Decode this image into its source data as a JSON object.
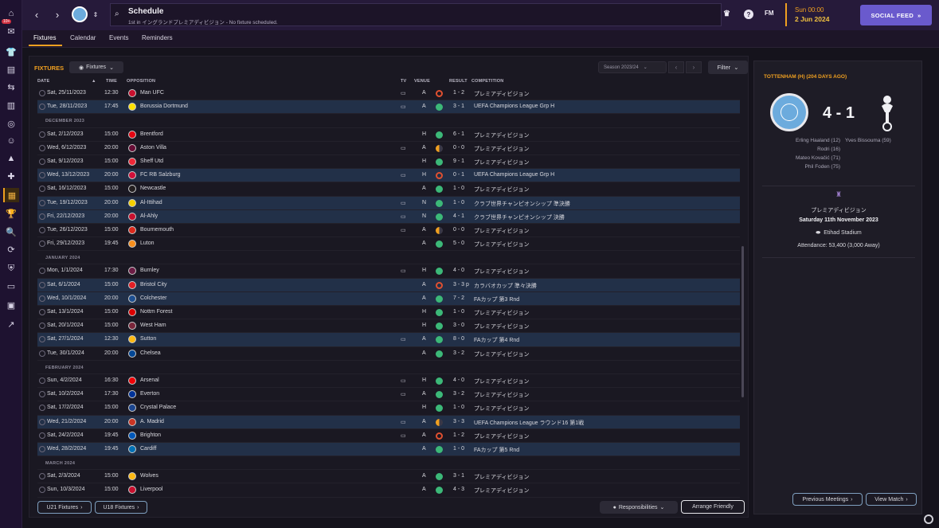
{
  "sidebar": {
    "badge": "10+",
    "items": [
      {
        "name": "home-icon",
        "glyph": "⌂"
      },
      {
        "name": "inbox-icon",
        "glyph": "✉"
      },
      {
        "name": "squad-icon",
        "glyph": "👕"
      },
      {
        "name": "reports-icon",
        "glyph": "▤"
      },
      {
        "name": "tactics-icon",
        "glyph": "⇆"
      },
      {
        "name": "data-hub-icon",
        "glyph": "▥"
      },
      {
        "name": "training-icon",
        "glyph": "◎"
      },
      {
        "name": "staff-icon",
        "glyph": "☺"
      },
      {
        "name": "dynamics-icon",
        "glyph": "▲"
      },
      {
        "name": "medical-icon",
        "glyph": "✚"
      },
      {
        "name": "schedule-icon",
        "glyph": "▦"
      },
      {
        "name": "competitions-icon",
        "glyph": "🏆"
      },
      {
        "name": "scouting-icon",
        "glyph": "🔍"
      },
      {
        "name": "transfers-icon",
        "glyph": "⟳"
      },
      {
        "name": "club-info-icon",
        "glyph": "⛨"
      },
      {
        "name": "club-vision-icon",
        "glyph": "▭"
      },
      {
        "name": "finances-icon",
        "glyph": "▣"
      },
      {
        "name": "dev-centre-icon",
        "glyph": "↗"
      }
    ]
  },
  "topbar": {
    "title": "Schedule",
    "subtitle": "1st in イングランドプレミアディビジョン - No fixture scheduled.",
    "fm": "FM",
    "time": "Sun 00:00",
    "date": "2 Jun 2024",
    "social": "SOCIAL FEED"
  },
  "tabs": [
    "Fixtures",
    "Calendar",
    "Events",
    "Reminders"
  ],
  "fixtures": {
    "title": "FIXTURES",
    "dropdown": "Fixtures",
    "season": "Season 2023/24",
    "filter": "Filter",
    "columns": {
      "date": "DATE",
      "time": "TIME",
      "opposition": "OPPOSITION",
      "tv": "TV",
      "venue": "VENUE",
      "result": "RESULT",
      "competition": "COMPETITION"
    },
    "rows": [
      {
        "date": "Sat, 25/11/2023",
        "time": "12:30",
        "opp": "Man UFC",
        "tv": true,
        "venue": "A",
        "res": "1 - 2",
        "comp": "プレミアディビジョン",
        "hl": false,
        "outcome": "L",
        "crest": "#c8102e"
      },
      {
        "date": "Tue, 28/11/2023",
        "time": "17:45",
        "opp": "Borussia Dortmund",
        "tv": true,
        "venue": "A",
        "res": "3 - 1",
        "comp": "UEFA Champions League Grp H",
        "hl": true,
        "outcome": "W",
        "crest": "#fde100"
      },
      {
        "month": "DECEMBER 2023"
      },
      {
        "date": "Sat, 2/12/2023",
        "time": "15:00",
        "opp": "Brentford",
        "tv": false,
        "venue": "H",
        "res": "6 - 1",
        "comp": "プレミアディビジョン",
        "hl": false,
        "outcome": "W",
        "crest": "#e30613"
      },
      {
        "date": "Wed, 6/12/2023",
        "time": "20:00",
        "opp": "Aston Villa",
        "tv": true,
        "venue": "A",
        "res": "0 - 0",
        "comp": "プレミアディビジョン",
        "hl": false,
        "outcome": "D",
        "crest": "#670e36"
      },
      {
        "date": "Sat, 9/12/2023",
        "time": "15:00",
        "opp": "Sheff Utd",
        "tv": false,
        "venue": "H",
        "res": "9 - 1",
        "comp": "プレミアディビジョン",
        "hl": false,
        "outcome": "W",
        "crest": "#ee2737"
      },
      {
        "date": "Wed, 13/12/2023",
        "time": "20:00",
        "opp": "FC RB Salzburg",
        "tv": true,
        "venue": "H",
        "res": "0 - 1",
        "comp": "UEFA Champions League Grp H",
        "hl": true,
        "outcome": "L",
        "crest": "#d0103a"
      },
      {
        "date": "Sat, 16/12/2023",
        "time": "15:00",
        "opp": "Newcastle",
        "tv": false,
        "venue": "A",
        "res": "1 - 0",
        "comp": "プレミアディビジョン",
        "hl": false,
        "outcome": "W",
        "crest": "#241f20"
      },
      {
        "date": "Tue, 19/12/2023",
        "time": "20:00",
        "opp": "Al-Ittihad",
        "tv": true,
        "venue": "N",
        "res": "1 - 0",
        "comp": "クラブ世界チャンピオンシップ 準決勝",
        "hl": true,
        "outcome": "W",
        "crest": "#f5d000"
      },
      {
        "date": "Fri, 22/12/2023",
        "time": "20:00",
        "opp": "Al-Ahly",
        "tv": true,
        "venue": "N",
        "res": "4 - 1",
        "comp": "クラブ世界チャンピオンシップ 決勝",
        "hl": true,
        "outcome": "W",
        "crest": "#c8102e"
      },
      {
        "date": "Tue, 26/12/2023",
        "time": "15:00",
        "opp": "Bournemouth",
        "tv": true,
        "venue": "A",
        "res": "0 - 0",
        "comp": "プレミアディビジョン",
        "hl": false,
        "outcome": "D",
        "crest": "#da291c"
      },
      {
        "date": "Fri, 29/12/2023",
        "time": "19:45",
        "opp": "Luton",
        "tv": false,
        "venue": "A",
        "res": "5 - 0",
        "comp": "プレミアディビジョン",
        "hl": false,
        "outcome": "W",
        "crest": "#f78f1e"
      },
      {
        "month": "JANUARY 2024"
      },
      {
        "date": "Mon, 1/1/2024",
        "time": "17:30",
        "opp": "Burnley",
        "tv": true,
        "venue": "H",
        "res": "4 - 0",
        "comp": "プレミアディビジョン",
        "hl": false,
        "outcome": "W",
        "crest": "#6c1d45"
      },
      {
        "date": "Sat, 6/1/2024",
        "time": "15:00",
        "opp": "Bristol City",
        "tv": false,
        "venue": "A",
        "res": "3 - 3 p",
        "comp": "カラバオカップ 準々決勝",
        "hl": true,
        "outcome": "L",
        "crest": "#e21f26"
      },
      {
        "date": "Wed, 10/1/2024",
        "time": "20:00",
        "opp": "Colchester",
        "tv": false,
        "venue": "A",
        "res": "7 - 2",
        "comp": "FAカップ 第3 Rnd",
        "hl": true,
        "outcome": "W",
        "crest": "#1d4f91"
      },
      {
        "date": "Sat, 13/1/2024",
        "time": "15:00",
        "opp": "Nottm Forest",
        "tv": false,
        "venue": "H",
        "res": "1 - 0",
        "comp": "プレミアディビジョン",
        "hl": false,
        "outcome": "W",
        "crest": "#dd0000"
      },
      {
        "date": "Sat, 20/1/2024",
        "time": "15:00",
        "opp": "West Ham",
        "tv": false,
        "venue": "H",
        "res": "3 - 0",
        "comp": "プレミアディビジョン",
        "hl": false,
        "outcome": "W",
        "crest": "#7a263a"
      },
      {
        "date": "Sat, 27/1/2024",
        "time": "12:30",
        "opp": "Sutton",
        "tv": true,
        "venue": "A",
        "res": "8 - 0",
        "comp": "FAカップ 第4 Rnd",
        "hl": true,
        "outcome": "W",
        "crest": "#fdb913"
      },
      {
        "date": "Tue, 30/1/2024",
        "time": "20:00",
        "opp": "Chelsea",
        "tv": false,
        "venue": "A",
        "res": "3 - 2",
        "comp": "プレミアディビジョン",
        "hl": false,
        "outcome": "W",
        "crest": "#034694"
      },
      {
        "month": "FEBRUARY 2024"
      },
      {
        "date": "Sun, 4/2/2024",
        "time": "16:30",
        "opp": "Arsenal",
        "tv": true,
        "venue": "H",
        "res": "4 - 0",
        "comp": "プレミアディビジョン",
        "hl": false,
        "outcome": "W",
        "crest": "#ef0107"
      },
      {
        "date": "Sat, 10/2/2024",
        "time": "17:30",
        "opp": "Everton",
        "tv": true,
        "venue": "A",
        "res": "3 - 2",
        "comp": "プレミアディビジョン",
        "hl": false,
        "outcome": "W",
        "crest": "#003399"
      },
      {
        "date": "Sat, 17/2/2024",
        "time": "15:00",
        "opp": "Crystal Palace",
        "tv": false,
        "venue": "H",
        "res": "1 - 0",
        "comp": "プレミアディビジョン",
        "hl": false,
        "outcome": "W",
        "crest": "#1b458f"
      },
      {
        "date": "Wed, 21/2/2024",
        "time": "20:00",
        "opp": "A. Madrid",
        "tv": true,
        "venue": "A",
        "res": "3 - 3",
        "comp": "UEFA Champions League ラウンド16 第1戦",
        "hl": true,
        "outcome": "D",
        "crest": "#cb3524"
      },
      {
        "date": "Sat, 24/2/2024",
        "time": "19:45",
        "opp": "Brighton",
        "tv": true,
        "venue": "A",
        "res": "1 - 2",
        "comp": "プレミアディビジョン",
        "hl": false,
        "outcome": "L",
        "crest": "#0057b8"
      },
      {
        "date": "Wed, 28/2/2024",
        "time": "19:45",
        "opp": "Cardiff",
        "tv": false,
        "venue": "A",
        "res": "1 - 0",
        "comp": "FAカップ 第5 Rnd",
        "hl": true,
        "outcome": "W",
        "crest": "#0070b5"
      },
      {
        "month": "MARCH 2024"
      },
      {
        "date": "Sat, 2/3/2024",
        "time": "15:00",
        "opp": "Wolves",
        "tv": false,
        "venue": "A",
        "res": "3 - 1",
        "comp": "プレミアディビジョン",
        "hl": false,
        "outcome": "W",
        "crest": "#fdb913"
      },
      {
        "date": "Sun, 10/3/2024",
        "time": "15:00",
        "opp": "Liverpool",
        "tv": false,
        "venue": "A",
        "res": "4 - 3",
        "comp": "プレミアディビジョン",
        "hl": false,
        "outcome": "W",
        "crest": "#c8102e"
      }
    ],
    "outcome_colors": {
      "W": "#3cb878",
      "D": "#f0a020",
      "L": "#e05030"
    },
    "buttons": {
      "u21": "U21 Fixtures",
      "u18": "U18 Fixtures",
      "resp": "Responsibilities",
      "friendly": "Arrange Friendly"
    }
  },
  "match": {
    "header": "TOTTENHAM (H) (204 DAYS AGO)",
    "score": "4 - 1",
    "home_scorers": [
      "Erling Haaland (12)",
      "Rodri (16)",
      "Mateo Kovačić (71)",
      "Phil Foden (75)"
    ],
    "away_scorers": [
      "Yves Bissouma (59)"
    ],
    "competition": "プレミアディビジョン",
    "date": "Saturday 11th November 2023",
    "stadium": "Etihad Stadium",
    "attendance": "Attendance: 53,400 (3,000 Away)",
    "btn_prev": "Previous Meetings",
    "btn_view": "View Match"
  }
}
